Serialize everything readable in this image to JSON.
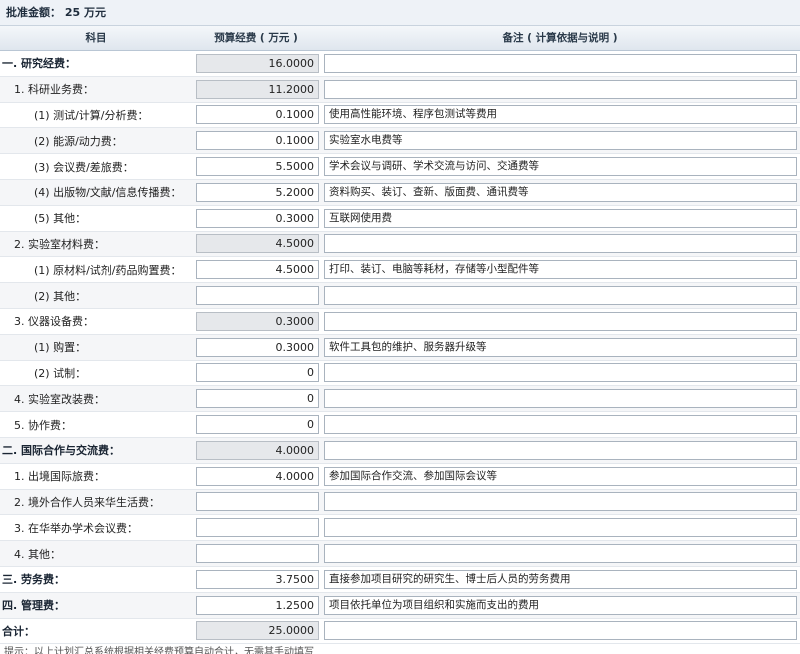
{
  "approved": {
    "label": "批准金额：",
    "value": "25 万元"
  },
  "columns": {
    "subject": "科目",
    "budget": "预算经费 ( 万元 )",
    "remark": "备注 ( 计算依据与说明 )"
  },
  "rows": [
    {
      "label": "一. 研究经费：",
      "amount": "16.0000",
      "note": "",
      "level": 0,
      "readonly": true
    },
    {
      "label": "1. 科研业务费：",
      "amount": "11.2000",
      "note": "",
      "level": 1,
      "readonly": true
    },
    {
      "label": "(1) 测试/计算/分析费：",
      "amount": "0.1000",
      "note": "使用高性能环境、程序包测试等费用",
      "level": 2,
      "readonly": false
    },
    {
      "label": "(2) 能源/动力费：",
      "amount": "0.1000",
      "note": "实验室水电费等",
      "level": 2,
      "readonly": false
    },
    {
      "label": "(3) 会议费/差旅费：",
      "amount": "5.5000",
      "note": "学术会议与调研、学术交流与访问、交通费等",
      "level": 2,
      "readonly": false
    },
    {
      "label": "(4) 出版物/文献/信息传播费：",
      "amount": "5.2000",
      "note": "资料购买、装订、查新、版面费、通讯费等",
      "level": 2,
      "readonly": false
    },
    {
      "label": "(5) 其他：",
      "amount": "0.3000",
      "note": "互联网使用费",
      "level": 2,
      "readonly": false
    },
    {
      "label": "2. 实验室材料费：",
      "amount": "4.5000",
      "note": "",
      "level": 1,
      "readonly": true
    },
    {
      "label": "(1) 原材料/试剂/药品购置费：",
      "amount": "4.5000",
      "note": "打印、装订、电脑等耗材，存储等小型配件等",
      "level": 2,
      "readonly": false
    },
    {
      "label": "(2) 其他：",
      "amount": "",
      "note": "",
      "level": 2,
      "readonly": false
    },
    {
      "label": "3. 仪器设备费：",
      "amount": "0.3000",
      "note": "",
      "level": 1,
      "readonly": true
    },
    {
      "label": "(1) 购置：",
      "amount": "0.3000",
      "note": "软件工具包的维护、服务器升级等",
      "level": 2,
      "readonly": false
    },
    {
      "label": "(2) 试制：",
      "amount": "0",
      "note": "",
      "level": 2,
      "readonly": false
    },
    {
      "label": "4. 实验室改装费：",
      "amount": "0",
      "note": "",
      "level": 1,
      "readonly": false
    },
    {
      "label": "5. 协作费：",
      "amount": "0",
      "note": "",
      "level": 1,
      "readonly": false
    },
    {
      "label": "二. 国际合作与交流费：",
      "amount": "4.0000",
      "note": "",
      "level": 0,
      "readonly": true
    },
    {
      "label": "1. 出境国际旅费：",
      "amount": "4.0000",
      "note": "参加国际合作交流、参加国际会议等",
      "level": 1,
      "readonly": false
    },
    {
      "label": "2. 境外合作人员来华生活费：",
      "amount": "",
      "note": "",
      "level": 1,
      "readonly": false
    },
    {
      "label": "3. 在华举办学术会议费：",
      "amount": "",
      "note": "",
      "level": 1,
      "readonly": false
    },
    {
      "label": "4. 其他：",
      "amount": "",
      "note": "",
      "level": 1,
      "readonly": false
    },
    {
      "label": "三. 劳务费：",
      "amount": "3.7500",
      "note": "直接参加项目研究的研究生、博士后人员的劳务费用",
      "level": 0,
      "readonly": false
    },
    {
      "label": "四. 管理费：",
      "amount": "1.2500",
      "note": "项目依托单位为项目组织和实施而支出的费用",
      "level": 0,
      "readonly": false
    },
    {
      "label": "合计：",
      "amount": "25.0000",
      "note": "",
      "level": 0,
      "readonly": true
    }
  ],
  "footer": "提示：以上计划汇总系统根据相关经费预算自动合计，无需其手动填写"
}
